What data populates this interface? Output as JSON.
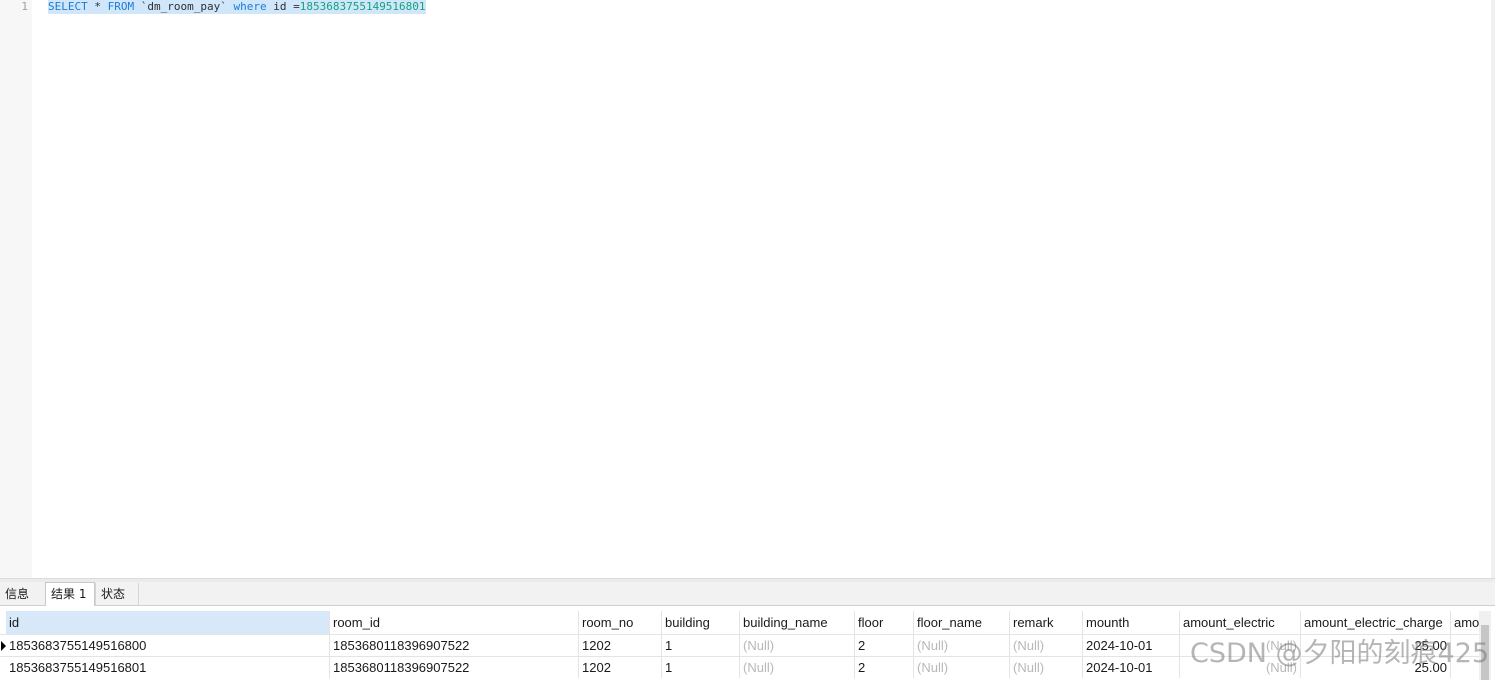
{
  "editor": {
    "line_number": "1",
    "query": {
      "select_kw": "SELECT",
      "star_from": " * ",
      "from_kw": "FROM",
      "table": " `dm_room_pay` ",
      "where_kw": "where",
      "condition": " id =",
      "id_value": "1853683755149516801"
    }
  },
  "tabs": [
    {
      "label": "信息"
    },
    {
      "label": "结果 1",
      "active": true
    },
    {
      "label": "状态"
    }
  ],
  "grid": {
    "columns": [
      "id",
      "room_id",
      "room_no",
      "building",
      "building_name",
      "floor",
      "floor_name",
      "remark",
      "mounth",
      "amount_electric",
      "amount_electric_charge",
      "amo"
    ],
    "rows": [
      [
        "1853683755149516800",
        "1853680118396907522",
        "1202",
        "1",
        "(Null)",
        "2",
        "(Null)",
        "(Null)",
        "2024-10-01",
        "(Null)",
        "25.00",
        ""
      ],
      [
        "1853683755149516801",
        "1853680118396907522",
        "1202",
        "1",
        "(Null)",
        "2",
        "(Null)",
        "(Null)",
        "2024-10-01",
        "(Null)",
        "25.00",
        ""
      ]
    ],
    "null_text": "(Null)"
  },
  "watermark": "CSDN @夕阳的刻痕425",
  "colors": {
    "keyword": "#1d7bd6",
    "number": "#16a37a",
    "selection": "#cfe6fb",
    "header_selected": "#d7e8f8",
    "null_text": "#b8b8b8"
  }
}
